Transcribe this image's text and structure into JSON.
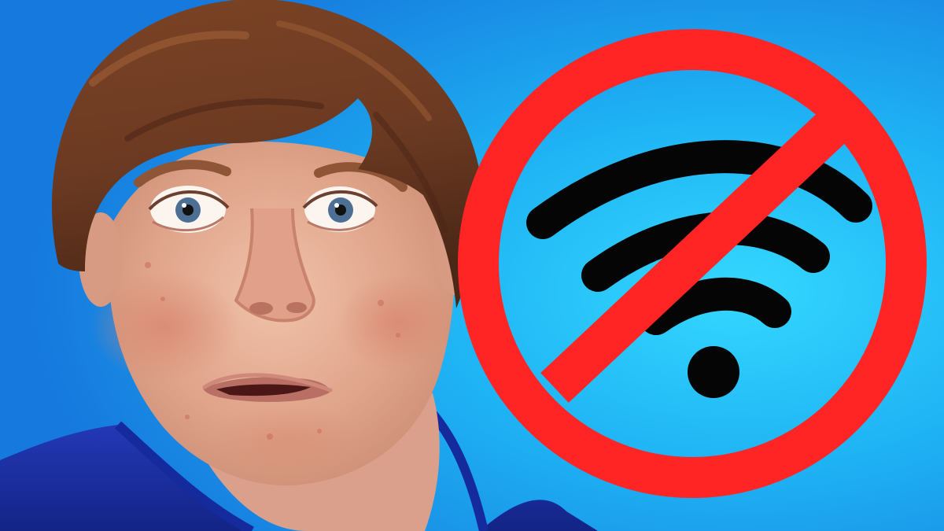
{
  "scene": {
    "description_label": "",
    "colors": {
      "background_center": "#2bd0ff",
      "background_edge": "#1a84e8",
      "shirt": "#1c2fa8",
      "skin": "#e7b29a",
      "skin_shadow": "#c98c73",
      "hair": "#6e3a22",
      "hair_highlight": "#a4633a",
      "iris": "#4d6f93",
      "prohibit_red": "#ff2a2a",
      "wifi_black": "#050505"
    },
    "icons": {
      "prohibition": "no-symbol-icon",
      "wifi": "wifi-icon"
    }
  }
}
